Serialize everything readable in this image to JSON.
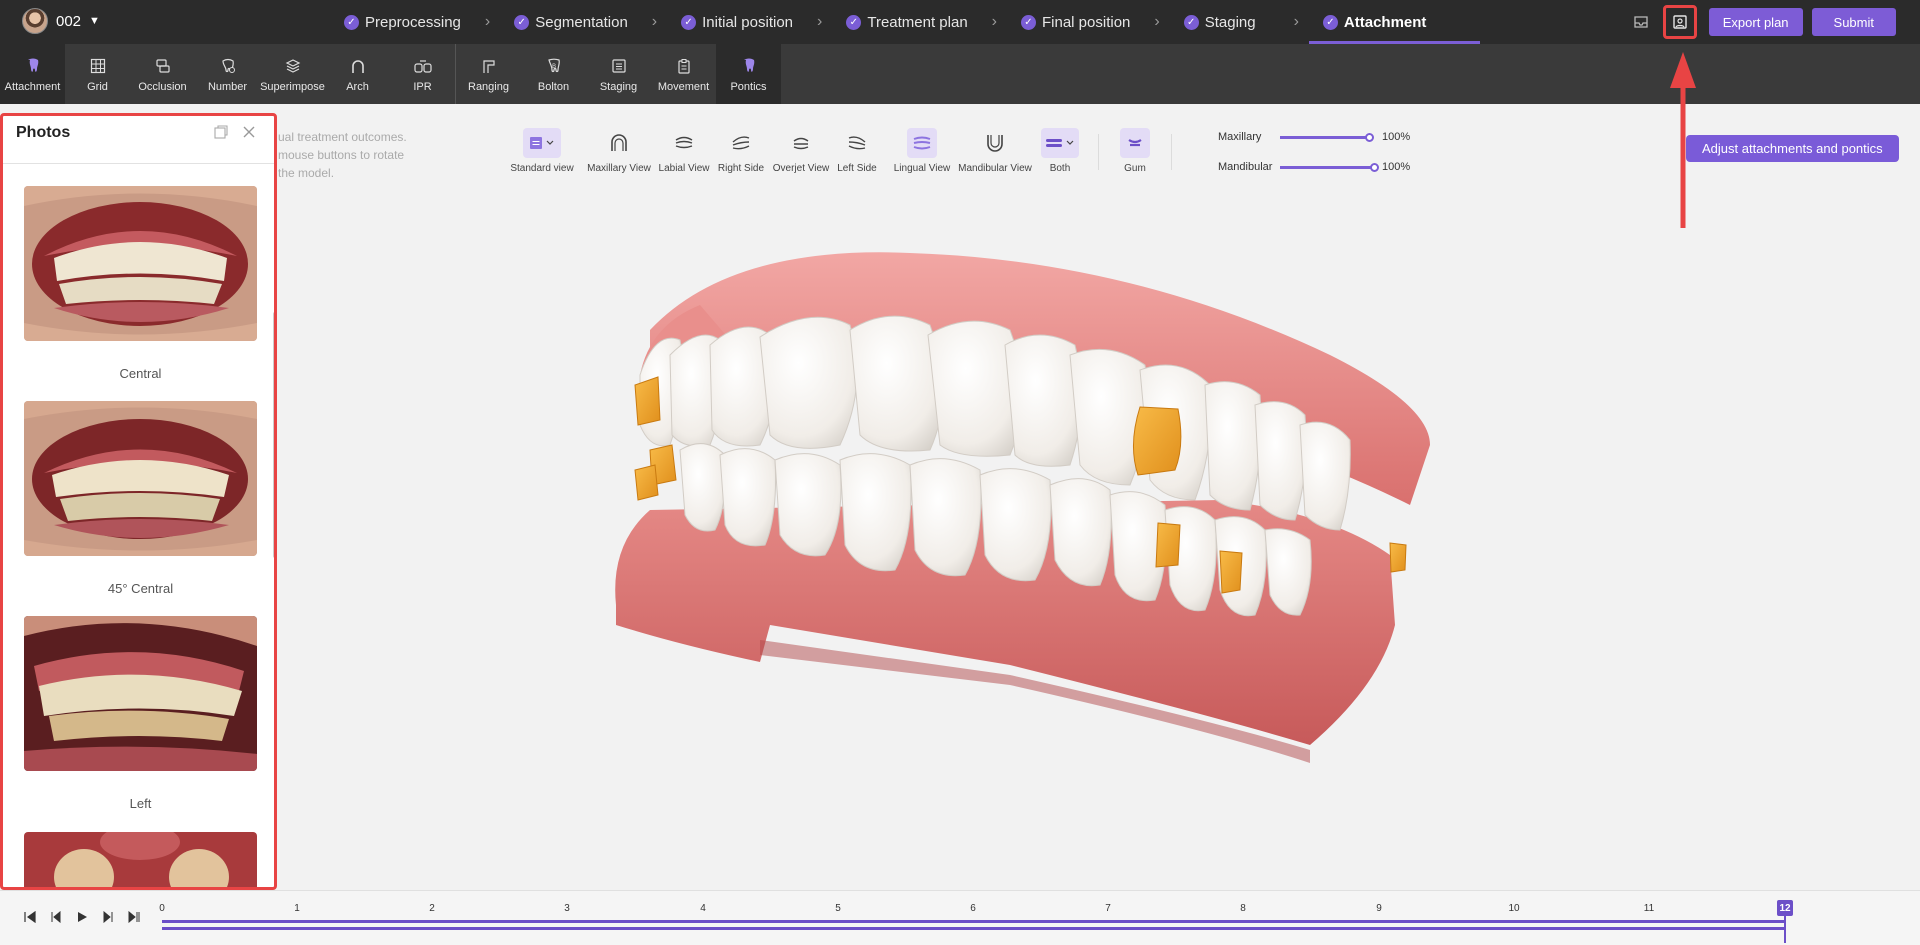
{
  "user": {
    "name": "002"
  },
  "steps": [
    {
      "label": "Preprocessing",
      "done": true
    },
    {
      "label": "Segmentation",
      "done": true
    },
    {
      "label": "Initial position",
      "done": true
    },
    {
      "label": "Treatment plan",
      "done": true
    },
    {
      "label": "Final position",
      "done": true
    },
    {
      "label": "Staging",
      "done": true
    },
    {
      "label": "Attachment",
      "done": true,
      "active": true
    }
  ],
  "actions": {
    "export": "Export plan",
    "submit": "Submit"
  },
  "tools": [
    {
      "label": "Attachment",
      "icon": "tooth-icon"
    },
    {
      "label": "Grid",
      "icon": "grid-icon"
    },
    {
      "label": "Occlusion",
      "icon": "occlusion-icon"
    },
    {
      "label": "Number",
      "icon": "number-icon"
    },
    {
      "label": "Superimpose",
      "icon": "layers-icon"
    },
    {
      "label": "Arch",
      "icon": "arch-icon"
    },
    {
      "label": "IPR",
      "icon": "ipr-icon"
    },
    {
      "label": "Ranging",
      "icon": "ranging-icon"
    },
    {
      "label": "Bolton",
      "icon": "bolton-icon"
    },
    {
      "label": "Staging",
      "icon": "staging-icon"
    },
    {
      "label": "Movement",
      "icon": "clipboard-icon"
    },
    {
      "label": "Pontics",
      "icon": "tooth-icon"
    }
  ],
  "photos": {
    "title": "Photos",
    "items": [
      {
        "label": "Central"
      },
      {
        "label": "45° Central"
      },
      {
        "label": "Left"
      },
      {
        "label": ""
      }
    ]
  },
  "hint": {
    "line1": "ual treatment outcomes.",
    "line2": "mouse buttons to rotate",
    "line3": "the model."
  },
  "views": [
    {
      "label": "Standard view",
      "selected": true
    },
    {
      "label": "Maxillary View"
    },
    {
      "label": "Labial View"
    },
    {
      "label": "Right Side"
    },
    {
      "label": "Overjet View"
    },
    {
      "label": "Left Side"
    },
    {
      "label": "Lingual View",
      "selected": true
    },
    {
      "label": "Mandibular View"
    },
    {
      "label": "Both",
      "selected": true
    },
    {
      "label": "Gum"
    }
  ],
  "sliders": [
    {
      "label": "Maxillary",
      "value": "100%"
    },
    {
      "label": "Mandibular",
      "value": "100%"
    }
  ],
  "adjust_button": "Adjust attachments and pontics",
  "timeline": {
    "ticks": [
      "0",
      "1",
      "2",
      "3",
      "4",
      "5",
      "6",
      "7",
      "8",
      "9",
      "10",
      "11"
    ],
    "current": "12"
  },
  "colors": {
    "accent": "#7b5ed6",
    "highlight": "#e84444",
    "gum": "#e07a78",
    "attachment": "#f0a030"
  }
}
